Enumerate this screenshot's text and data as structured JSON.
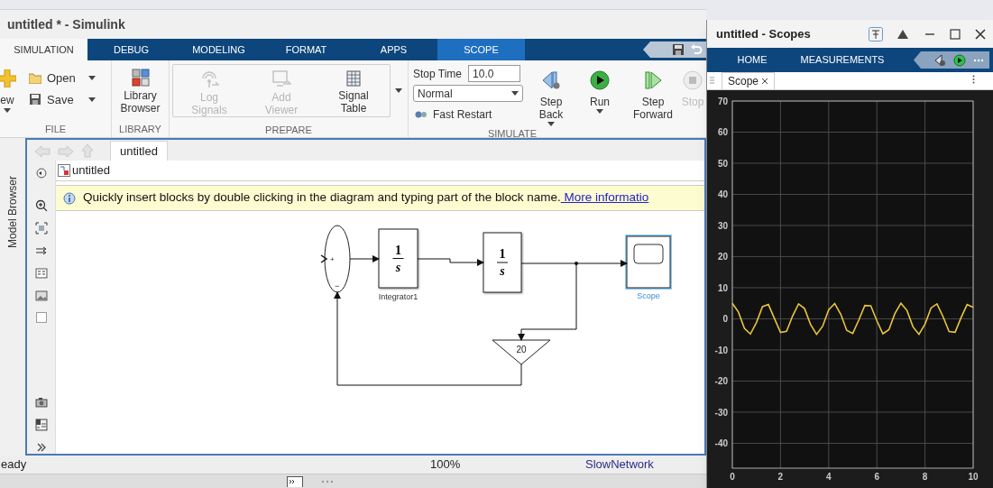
{
  "simulink": {
    "title": "untitled * - Simulink",
    "tabs": [
      {
        "label": "SIMULATION",
        "selected": true,
        "kind": "standard"
      },
      {
        "label": "DEBUG",
        "selected": false,
        "kind": "standard"
      },
      {
        "label": "MODELING",
        "selected": false,
        "kind": "standard"
      },
      {
        "label": "FORMAT",
        "selected": false,
        "kind": "standard"
      },
      {
        "label": "APPS",
        "selected": false,
        "kind": "standard"
      },
      {
        "label": "SCOPE",
        "selected": false,
        "kind": "contextual"
      }
    ],
    "file": {
      "label": "FILE",
      "new": "ew",
      "open": "Open",
      "save": "Save"
    },
    "library": {
      "label": "LIBRARY",
      "button": "Library Browser"
    },
    "prepare": {
      "label": "PREPARE",
      "buttons": [
        {
          "label": "Log Signals",
          "disabled": true,
          "kind": "log"
        },
        {
          "label": "Add Viewer",
          "disabled": true,
          "kind": "viewer"
        },
        {
          "label": "Signal Table",
          "disabled": false,
          "kind": "table"
        }
      ]
    },
    "simulate": {
      "label": "SIMULATE",
      "stop_time_label": "Stop Time",
      "stop_time": "10.0",
      "mode": "Normal",
      "fast_restart": "Fast Restart",
      "buttons": [
        {
          "label": "Step Back",
          "kind": "step_back",
          "disabled": false,
          "dropdown": true
        },
        {
          "label": "Run",
          "kind": "run",
          "disabled": false,
          "dropdown": true
        },
        {
          "label": "Step Forward",
          "kind": "step_forward",
          "disabled": false,
          "dropdown": false
        },
        {
          "label": "Stop",
          "kind": "stop",
          "disabled": true,
          "dropdown": false
        }
      ]
    },
    "model_browser": "Model Browser",
    "editor_tab": "untitled",
    "breadcrumb": "untitled",
    "info_bar": {
      "text": "Quickly insert blocks by double clicking in the diagram and typing part of the block name.",
      "link": " More informatio"
    },
    "blocks": [
      {
        "kind": "sum",
        "signs": [
          "+",
          "−"
        ]
      },
      {
        "kind": "integrator",
        "numerator": "1",
        "denominator": "s",
        "label": "Integrator1"
      },
      {
        "kind": "integrator",
        "numerator": "1",
        "denominator": "s"
      },
      {
        "kind": "scope",
        "label": "Scope",
        "selected": true
      },
      {
        "kind": "gain",
        "value": "20"
      }
    ],
    "status_bar": {
      "state": "eady",
      "zoom": "100%",
      "solver": "SlowNetwork"
    }
  },
  "scopes": {
    "title": "untitled - Scopes",
    "tabs": [
      "HOME",
      "MEASUREMENTS"
    ],
    "document_tab": "Scope",
    "chart_data": {
      "type": "line",
      "grid": true,
      "xlim": [
        0,
        10
      ],
      "ylim": [
        -48,
        70
      ],
      "xticks": [
        0,
        2,
        4,
        6,
        8,
        10
      ],
      "yticks": [
        -40,
        -30,
        -20,
        -10,
        0,
        10,
        20,
        30,
        40,
        50,
        60,
        70
      ],
      "x": [
        0,
        0.25,
        0.5,
        0.75,
        1,
        1.25,
        1.5,
        1.75,
        2,
        2.25,
        2.5,
        2.75,
        3,
        3.25,
        3.5,
        3.75,
        4,
        4.25,
        4.5,
        4.75,
        5,
        5.25,
        5.5,
        5.75,
        6,
        6.25,
        6.5,
        6.75,
        7,
        7.25,
        7.5,
        7.75,
        8,
        8.25,
        8.5,
        8.75,
        9,
        9.25,
        9.5,
        9.75,
        10
      ],
      "series": [
        {
          "color": "#e8c53a",
          "values": [
            5,
            2.2,
            -3.1,
            -4.9,
            -1.2,
            3.9,
            4.6,
            0.1,
            -4.4,
            -4,
            0.9,
            4.8,
            3.3,
            -1.9,
            -5,
            -2.4,
            2.9,
            4.9,
            1.5,
            -3.7,
            -4.7,
            -0.4,
            4.3,
            4.2,
            -0.6,
            -4.8,
            -3.5,
            1.7,
            5,
            2.7,
            -2.6,
            -5,
            -1.7,
            3.5,
            4.8,
            0.7,
            -4.1,
            -4.3,
            0.4,
            4.6,
            3.7
          ]
        }
      ]
    }
  }
}
